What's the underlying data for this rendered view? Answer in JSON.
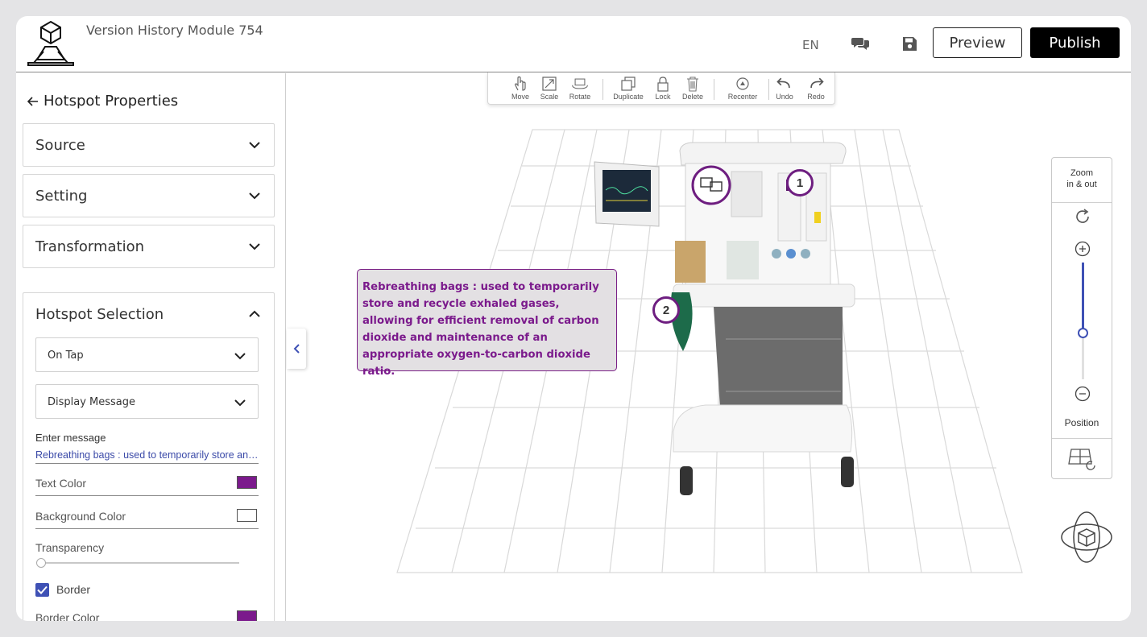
{
  "header": {
    "title": "Version History Module 754",
    "language": "EN",
    "preview_label": "Preview",
    "publish_label": "Publish"
  },
  "panel": {
    "title": "Hotspot Properties",
    "sections": [
      {
        "label": "Source",
        "expanded": false
      },
      {
        "label": "Setting",
        "expanded": false
      },
      {
        "label": "Transformation",
        "expanded": false
      },
      {
        "label": "Hotspot Selection",
        "expanded": true
      }
    ],
    "trigger_select": "On Tap",
    "action_select": "Display Message",
    "message_label": "Enter message",
    "message_value": "Rebreathing bags : used to temporarily store and recycle exhaled gases, allowing for efficient removal of carbon dioxide and maintenance of an appropriate oxygen-to-carbon dioxide ratio.",
    "text_color_label": "Text Color",
    "text_color": "#7b1a8c",
    "bg_color_label": "Background Color",
    "bg_color": "#ffffff",
    "transparency_label": "Transparency",
    "transparency": 0,
    "border_label": "Border",
    "border_checked": true,
    "border_color_label": "Border Color",
    "border_color": "#7b1a8c"
  },
  "toolbar": {
    "move": "Move",
    "scale": "Scale",
    "rotate": "Rotate",
    "duplicate": "Duplicate",
    "lock": "Lock",
    "delete": "Delete",
    "recenter": "Recenter",
    "undo": "Undo",
    "redo": "Redo"
  },
  "zoom": {
    "label_line1": "Zoom",
    "label_line2": "in & out",
    "level": 0.4,
    "position_label": "Position"
  },
  "callout": {
    "text": " Rebreathing bags : used to temporarily store and recycle exhaled gases, allowing for efficient removal of carbon dioxide and maintenance of an appropriate oxygen-to-carbon dioxide ratio.",
    "text_color": "#7b1a8c",
    "background": "#e3e0e3"
  },
  "hotspots": [
    {
      "label": "1"
    },
    {
      "label": "2"
    }
  ],
  "colors": {
    "accent": "#3f51b5",
    "hotspot_ring": "#6e1e80"
  }
}
